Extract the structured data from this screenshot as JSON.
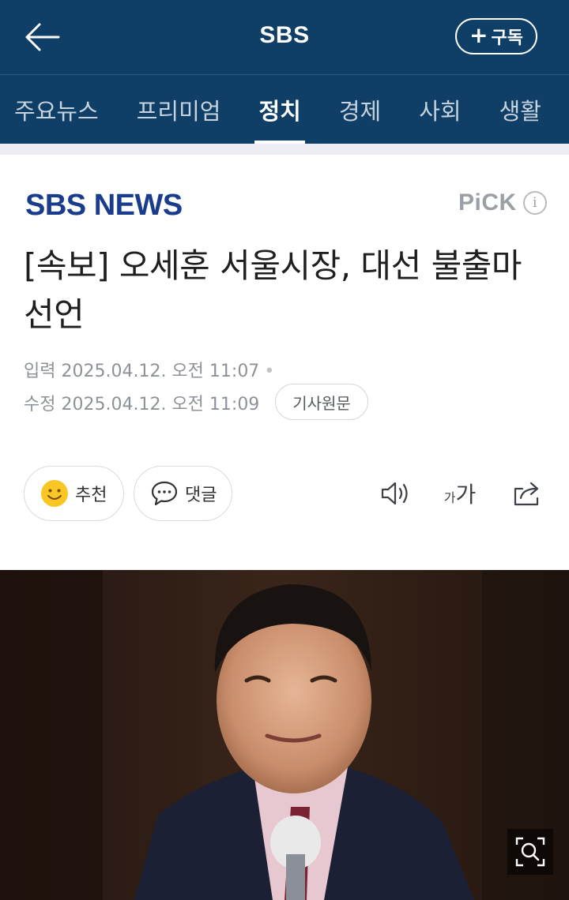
{
  "header": {
    "title": "SBS",
    "subscribe_label": "구독",
    "back_icon": "back-arrow-icon",
    "plus_icon": "plus-icon"
  },
  "tabs": [
    {
      "label": "주요뉴스",
      "active": false
    },
    {
      "label": "프리미엄",
      "active": false
    },
    {
      "label": "정치",
      "active": true
    },
    {
      "label": "경제",
      "active": false
    },
    {
      "label": "사회",
      "active": false
    },
    {
      "label": "생활",
      "active": false
    }
  ],
  "article": {
    "publisher_logo": "SBS NEWS",
    "pick_label": "PiCK",
    "pick_info": "i",
    "headline": "[속보] 오세훈 서울시장, 대선 불출마 선언",
    "input_label": "입력",
    "input_time": "2025.04.12. 오전 11:07",
    "modified_label": "수정",
    "modified_time": "2025.04.12. 오전 11:09",
    "original_button": "기사원문"
  },
  "actions": {
    "recommend_label": "추천",
    "comment_label": "댓글",
    "font_small": "가",
    "font_big": "가"
  },
  "colors": {
    "header_bg": "#0f3f66",
    "logo_blue": "#1a3c8c",
    "emoji_yellow": "#f9c623"
  }
}
